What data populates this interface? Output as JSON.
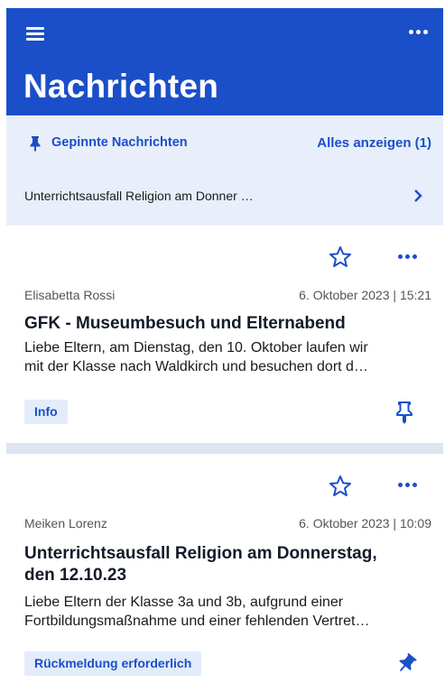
{
  "header": {
    "title": "Nachrichten",
    "menu_icon": "hamburger-menu-icon",
    "more_icon": "more-horizontal-icon"
  },
  "pinned": {
    "title": "Gepinnte Nachrichten",
    "show_all": "Alles anzeigen (1)",
    "items": [
      {
        "text": "Unterrichtsausfall Religion am Donner …"
      }
    ]
  },
  "messages": [
    {
      "author": "Elisabetta Rossi",
      "date": "6. Oktober 2023 | 15:21",
      "title": "GFK - Museumbesuch und Elternabend",
      "preview_line1": "Liebe Eltern, am Dienstag, den 10. Oktober laufen wir",
      "preview_line2": "mit der Klasse nach Waldkirch und besuchen dort d…",
      "tag": "Info",
      "pinned": false
    },
    {
      "author": "Meiken Lorenz",
      "date": "6. Oktober 2023 | 10:09",
      "title_line1": "Unterrichtsausfall Religion am Donnerstag,",
      "title_line2": "den 12.10.23",
      "preview_line1": "Liebe Eltern der Klasse 3a und 3b, aufgrund einer",
      "preview_line2": "Fortbildungsmaßnahme und einer fehlenden Vertret…",
      "tag": "Rückmeldung erforderlich",
      "pinned": true
    }
  ],
  "colors": {
    "primary": "#1a4fc9",
    "pinned_bg": "#e8effa",
    "tag_bg": "#e3ecfa",
    "separator": "#dde5f1"
  }
}
